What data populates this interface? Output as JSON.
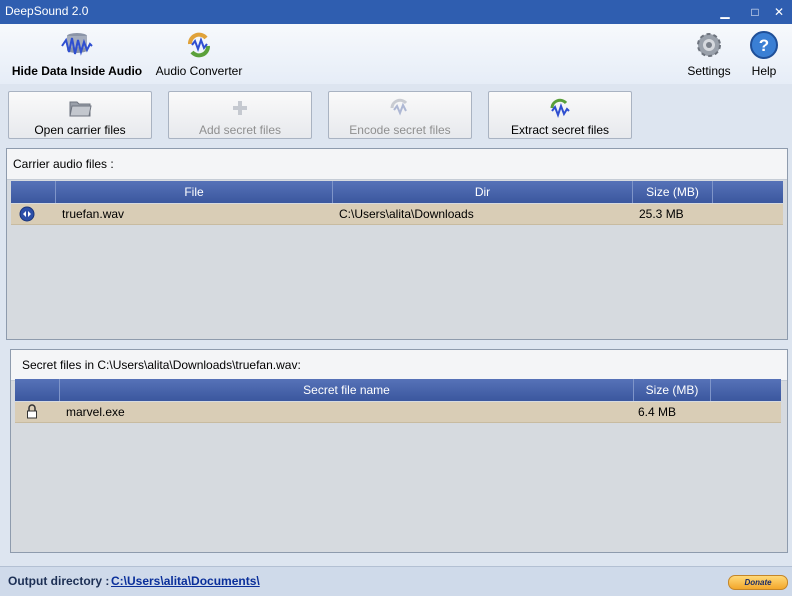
{
  "window": {
    "title": "DeepSound 2.0",
    "min": "▁",
    "max": "□",
    "close": "✕"
  },
  "toolbar": {
    "hide_data": "Hide Data Inside Audio",
    "audio_converter": "Audio Converter",
    "settings": "Settings",
    "help": "Help"
  },
  "actions": {
    "open": "Open carrier files",
    "add": "Add secret files",
    "encode": "Encode secret files",
    "extract": "Extract secret files"
  },
  "carrier": {
    "caption": "Carrier audio files :",
    "headers": {
      "file": "File",
      "dir": "Dir",
      "size": "Size (MB)"
    },
    "rows": [
      {
        "file": "truefan.wav",
        "dir": "C:\\Users\\alita\\Downloads",
        "size": "25.3 MB"
      }
    ]
  },
  "secret": {
    "caption": "Secret files in C:\\Users\\alita\\Downloads\\truefan.wav:",
    "headers": {
      "name": "Secret file name",
      "size": "Size (MB)"
    },
    "rows": [
      {
        "name": "marvel.exe",
        "size": "6.4 MB"
      }
    ]
  },
  "status": {
    "output_label": "Output directory :",
    "output_path": "C:\\Users\\alita\\Documents\\",
    "donate": "Donate"
  },
  "colors": {
    "titlebar": "#2f5eb0",
    "grid_header": "#4a66ad",
    "row_selected": "#d9cdb6"
  }
}
